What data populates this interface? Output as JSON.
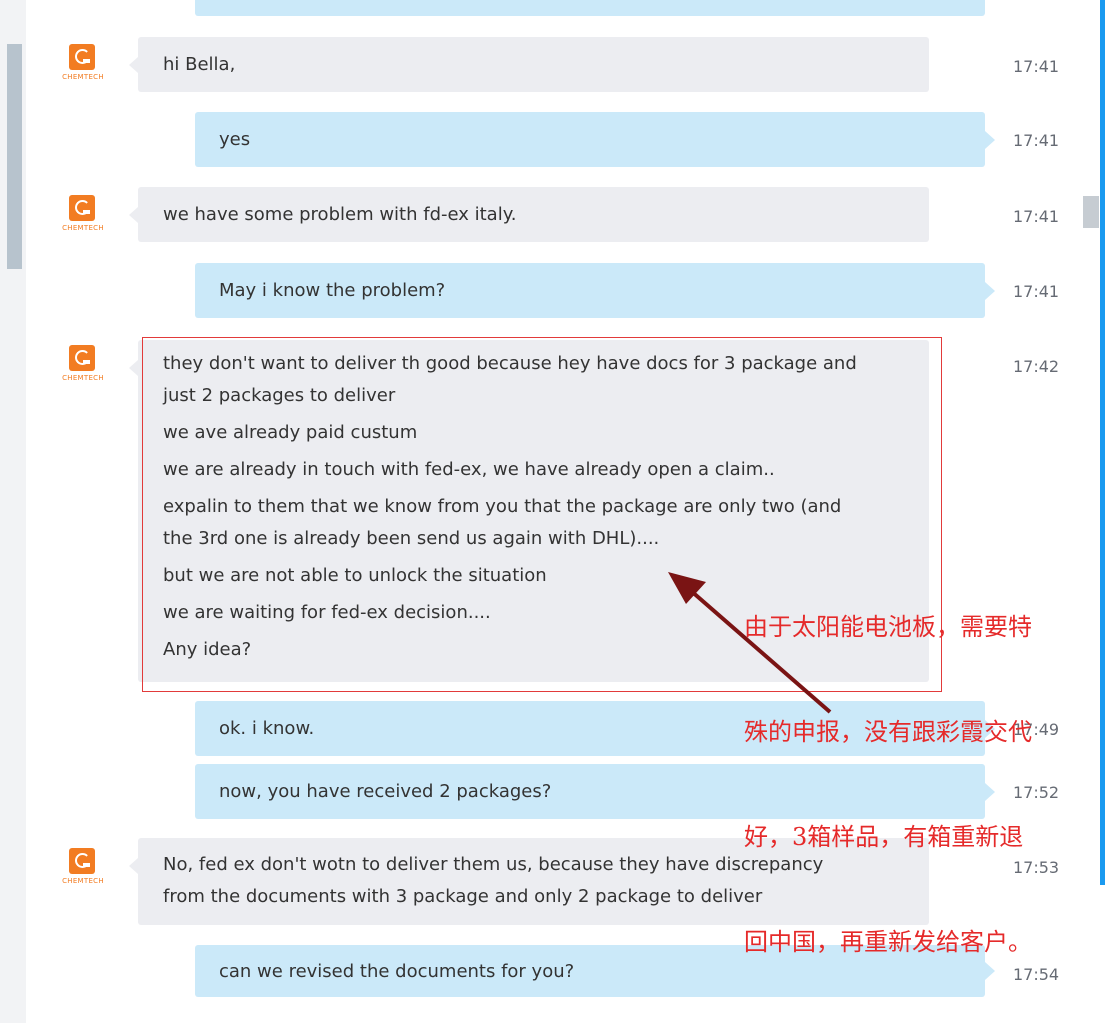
{
  "avatar_brand": "CHEMTECH",
  "messages": [
    {
      "time": "17:41",
      "lines": [
        "hi Bella,"
      ]
    },
    {
      "time": "17:41",
      "lines": [
        "yes"
      ]
    },
    {
      "time": "17:41",
      "lines": [
        "we have some problem with fd-ex italy."
      ]
    },
    {
      "time": "17:41",
      "lines": [
        "May i know the problem?"
      ]
    },
    {
      "time": "17:42",
      "lines": [
        "they don't want to deliver th good because hey have docs for 3 package and",
        "just 2 packages to deliver",
        "we ave already paid custum",
        "we are already in touch with fed-ex, we have already open a claim..",
        "expalin to them that we know from you that the package are only two (and",
        "the 3rd one is already been send us again with DHL)....",
        "but we are not able to unlock the situation",
        "we are waiting for fed-ex decision....",
        "Any idea?"
      ]
    },
    {
      "time": "17:49",
      "lines": [
        "ok. i know."
      ]
    },
    {
      "time": "17:52",
      "lines": [
        "now, you have received 2 packages?"
      ]
    },
    {
      "time": "17:53",
      "lines": [
        "No, fed ex don't wotn to deliver them us, because they have discrepancy",
        "from the documents with 3 package and only 2 package to deliver"
      ]
    },
    {
      "time": "17:54",
      "lines": [
        "can we revised the documents for you?"
      ]
    }
  ],
  "annotation": {
    "lines": [
      "由于太阳能电池板，需要特",
      "殊的申报，没有跟彩霞交代",
      "好，3箱样品，有箱重新退",
      "回中国，再重新发给客户。"
    ],
    "color": "#e52a2a"
  },
  "colors": {
    "incoming_bubble": "#ecedf1",
    "outgoing_bubble": "#cbe9f9",
    "accent_rule": "#1a9af0",
    "avatar": "#f27c22",
    "arrow": "#7a1414"
  }
}
